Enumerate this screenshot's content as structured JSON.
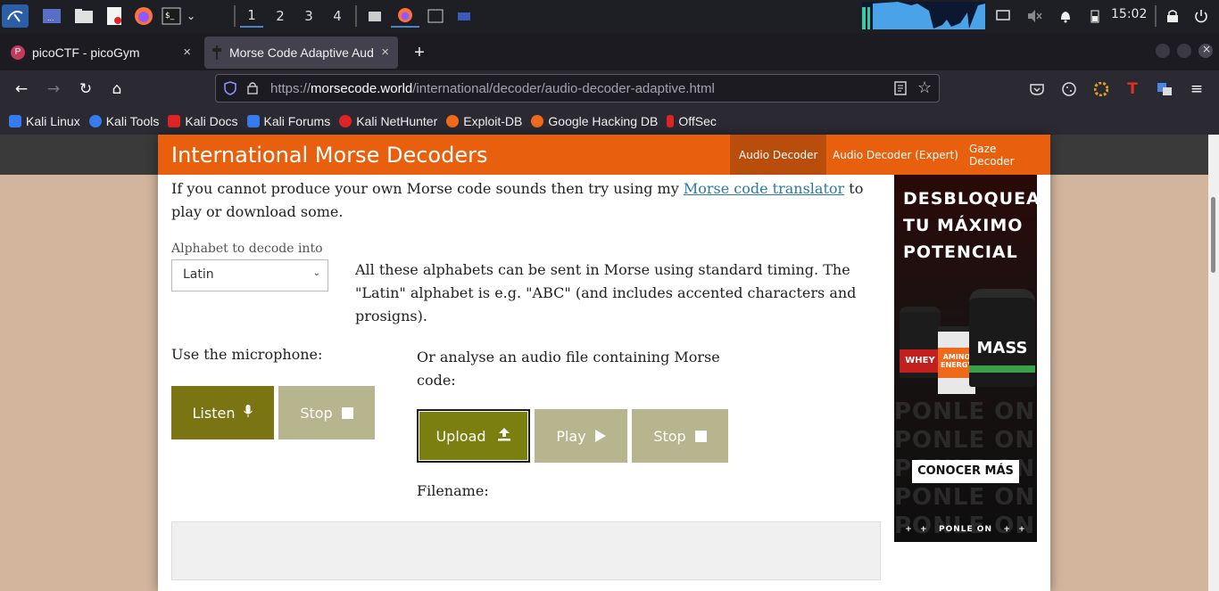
{
  "taskbar": {
    "workspaces": [
      "1",
      "2",
      "3",
      "4"
    ],
    "clock": "15:02"
  },
  "tabs": [
    {
      "title": "picoCTF - picoGym",
      "close": "×"
    },
    {
      "title": "Morse Code Adaptive Aud",
      "close": "×"
    }
  ],
  "new_tab": "+",
  "nav": {
    "url_scheme": "https://",
    "url_host": "morsecode.world",
    "url_path": "/international/decoder/audio-decoder-adaptive.html"
  },
  "bookmarks": [
    {
      "label": "Kali Linux",
      "color": "#367bf0"
    },
    {
      "label": "Kali Tools",
      "color": "#367bf0"
    },
    {
      "label": "Kali Docs",
      "color": "#e02424"
    },
    {
      "label": "Kali Forums",
      "color": "#367bf0"
    },
    {
      "label": "Kali NetHunter",
      "color": "#e02424"
    },
    {
      "label": "Exploit-DB",
      "color": "#f06a1a"
    },
    {
      "label": "Google Hacking DB",
      "color": "#f06a1a"
    },
    {
      "label": "OffSec",
      "color": "#e02424"
    }
  ],
  "site": {
    "title": "International Morse Decoders",
    "menu": [
      "Audio Decoder",
      "Audio Decoder (Expert)",
      "Gaze Decoder"
    ]
  },
  "content": {
    "intro_before": "If you cannot produce your own Morse code sounds then try using my",
    "intro_link": "Morse code translator",
    "intro_after": "to play or download some.",
    "alphabet_label": "Alphabet to decode into",
    "alphabet_value": "Latin",
    "alphabet_desc": "All these alphabets can be sent in Morse using standard timing. The \"Latin\" alphabet is e.g. \"ABC\" (and includes accented characters and prosigns).",
    "mic_label": "Use the microphone:",
    "listen": "Listen",
    "stop1": "Stop",
    "file_label": "Or analyse an audio file containing Morse code:",
    "upload": "Upload",
    "play": "Play",
    "stop2": "Stop",
    "filename_label": "Filename:"
  },
  "ad": {
    "headline1": "DESBLOQUEA",
    "headline2": "TU MÁXIMO",
    "headline3": "POTENCIAL",
    "product1": "WHEY",
    "product2": "AMINO ENERGY",
    "product3": "MASS",
    "cta": "CONOCER MÁS",
    "footer": "PONLE ON",
    "bg_text": "PONLE ON"
  }
}
